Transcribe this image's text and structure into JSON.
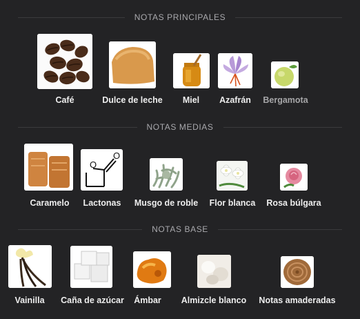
{
  "sections": [
    {
      "title": "NOTAS PRINCIPALES",
      "notes": [
        {
          "label": "Café",
          "icon": "coffee-beans-icon"
        },
        {
          "label": "Dulce de leche",
          "icon": "dulce-de-leche-icon"
        },
        {
          "label": "Miel",
          "icon": "honey-jar-icon"
        },
        {
          "label": "Azafrán",
          "icon": "saffron-flower-icon"
        },
        {
          "label": "Bergamota",
          "icon": "bergamot-fruit-icon"
        }
      ]
    },
    {
      "title": "NOTAS MEDIAS",
      "notes": [
        {
          "label": "Caramelo",
          "icon": "caramel-icon"
        },
        {
          "label": "Lactonas",
          "icon": "lactone-structure-icon"
        },
        {
          "label": "Musgo de roble",
          "icon": "oakmoss-icon"
        },
        {
          "label": "Flor blanca",
          "icon": "white-flower-icon"
        },
        {
          "label": "Rosa búlgara",
          "icon": "pink-rose-icon"
        }
      ]
    },
    {
      "title": "NOTAS BASE",
      "notes": [
        {
          "label": "Vainilla",
          "icon": "vanilla-icon"
        },
        {
          "label": "Caña de azúcar",
          "icon": "sugar-cubes-icon"
        },
        {
          "label": "Ámbar",
          "icon": "amber-icon"
        },
        {
          "label": "Almizcle blanco",
          "icon": "white-musk-icon"
        },
        {
          "label": "Notas amaderadas",
          "icon": "wood-icon"
        }
      ]
    }
  ]
}
